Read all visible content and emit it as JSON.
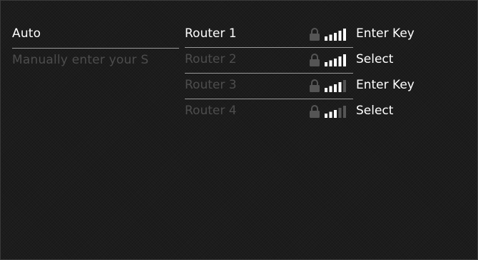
{
  "left_menu": {
    "items": [
      {
        "label": "Auto"
      },
      {
        "label": "Manually enter your S"
      }
    ]
  },
  "networks": [
    {
      "name": "Router 1",
      "secured": true,
      "signal_bars": 5,
      "action": "Enter Key"
    },
    {
      "name": "Router 2",
      "secured": true,
      "signal_bars": 5,
      "action": "Select"
    },
    {
      "name": "Router 3",
      "secured": true,
      "signal_bars": 4,
      "action": "Enter Key"
    },
    {
      "name": "Router 4",
      "secured": true,
      "signal_bars": 3,
      "action": "Select"
    }
  ],
  "colors": {
    "background": "#1c1c1c",
    "text_active": "#ffffff",
    "text_dim": "#4d4d4d",
    "bar_on": "#ffffff",
    "bar_off": "#555555",
    "lock": "#555555"
  }
}
